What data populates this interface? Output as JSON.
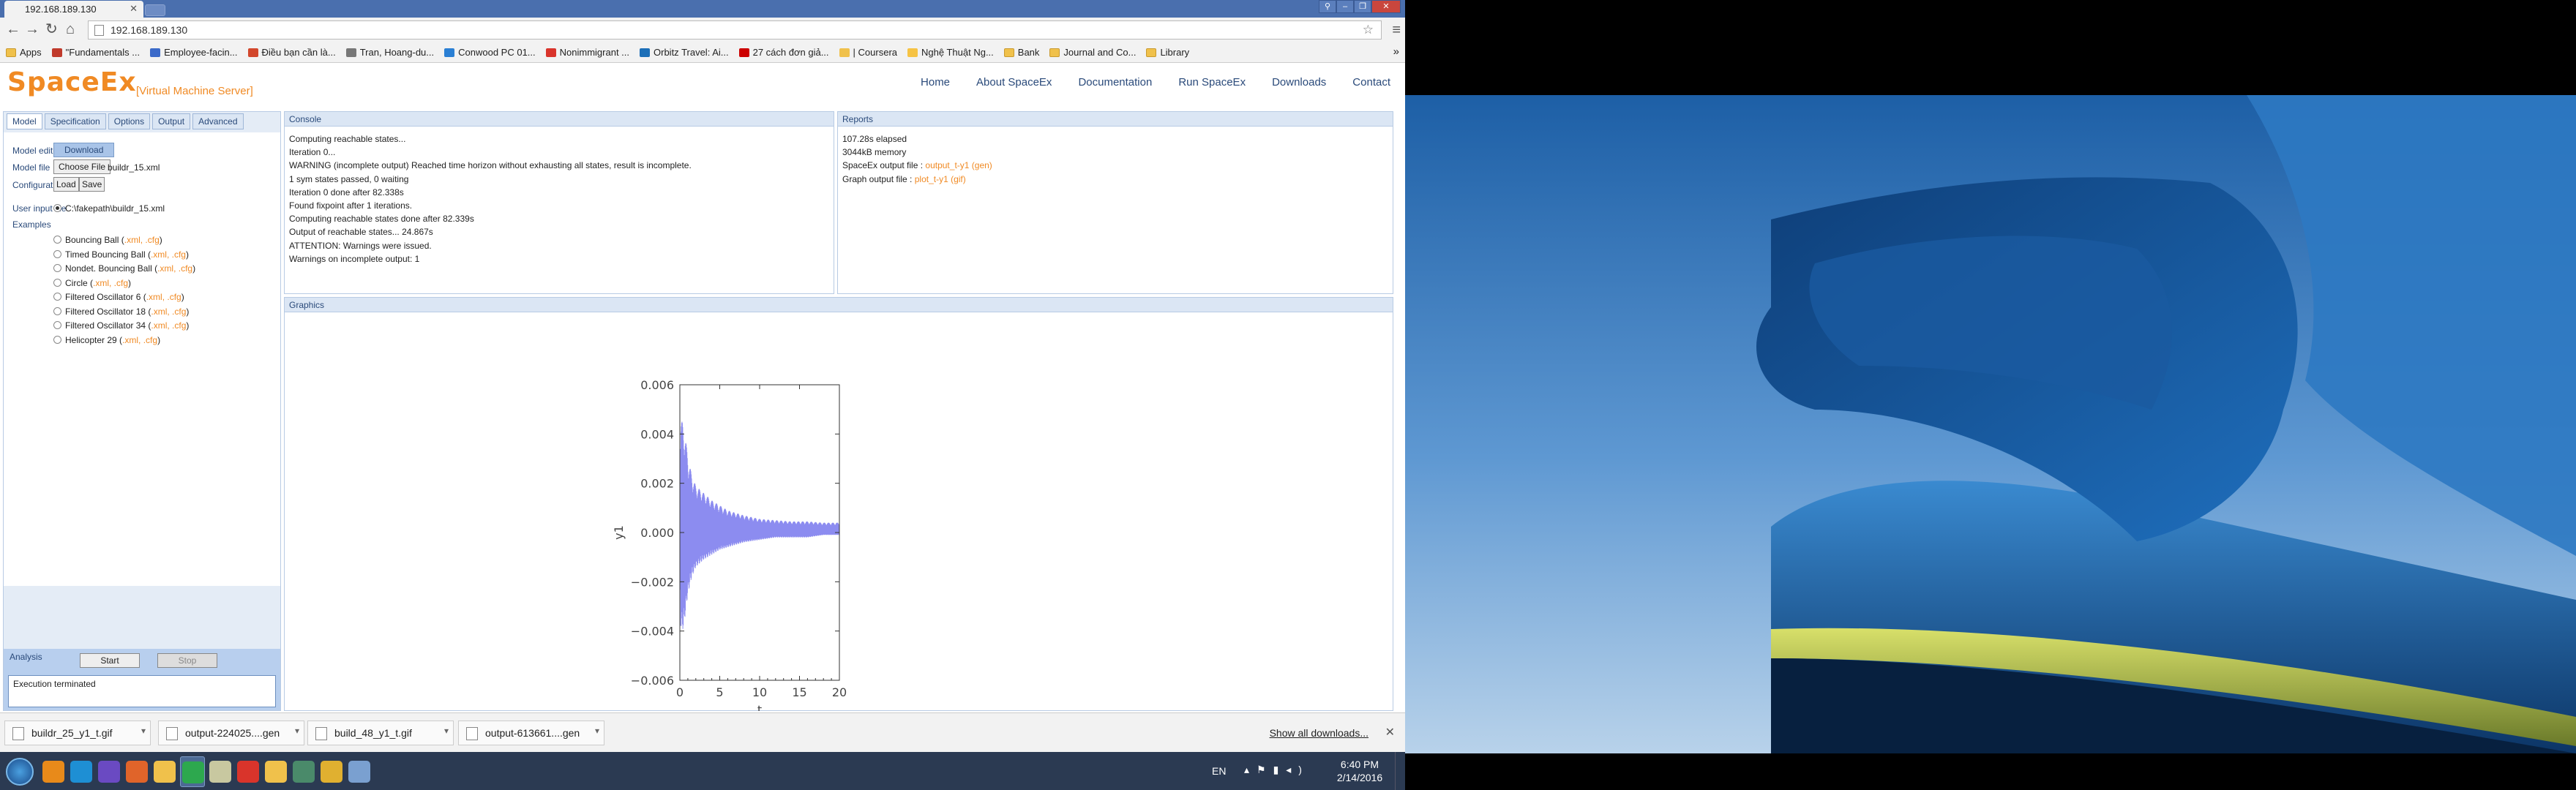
{
  "browser": {
    "tab_title": "192.168.189.130",
    "url": "192.168.189.130",
    "bookmarks": [
      "Apps",
      "\"Fundamentals ...",
      "Employee-facin...",
      "Điều bạn cần là...",
      "Tran, Hoang-du...",
      "Conwood PC 01...",
      "Nonimmigrant ...",
      "Orbitz Travel: Ai...",
      "27 cách đơn giả...",
      "| Coursera",
      "Nghệ Thuật Ng...",
      "Bank",
      "Journal and Co...",
      "Library"
    ],
    "bookmarks_more": "»"
  },
  "site": {
    "logo": "SpaceEx",
    "logo_sub": "[Virtual Machine Server]",
    "nav": [
      "Home",
      "About SpaceEx",
      "Documentation",
      "Run SpaceEx",
      "Downloads",
      "Contact"
    ]
  },
  "side": {
    "tabs": [
      "Model",
      "Specification",
      "Options",
      "Output",
      "Advanced"
    ],
    "model_editor_label": "Model editor",
    "download_btn": "Download",
    "model_file_label": "Model file",
    "choose_file_btn": "Choose File",
    "model_file_name": "buildr_15.xml",
    "config_file_label": "Configuration file",
    "load_btn": "Load",
    "save_btn": "Save",
    "user_input_label": "User input file",
    "user_input_value": "C:\\fakepath\\buildr_15.xml",
    "examples_label": "Examples",
    "examples": [
      {
        "name": "Bouncing Ball",
        "links": ".xml, .cfg"
      },
      {
        "name": "Timed Bouncing Ball",
        "links": ".xml, .cfg"
      },
      {
        "name": "Nondet. Bouncing Ball",
        "links": ".xml, .cfg"
      },
      {
        "name": "Circle",
        "links": ".xml, .cfg"
      },
      {
        "name": "Filtered Oscillator 6",
        "links": ".xml, .cfg"
      },
      {
        "name": "Filtered Oscillator 18",
        "links": ".xml, .cfg"
      },
      {
        "name": "Filtered Oscillator 34",
        "links": ".xml, .cfg"
      },
      {
        "name": "Helicopter 29",
        "links": ".xml, .cfg"
      }
    ],
    "analysis_label": "Analysis",
    "start_btn": "Start",
    "stop_btn": "Stop",
    "status_text": "Execution terminated"
  },
  "console": {
    "title": "Console",
    "lines": [
      "Computing reachable states...",
      "Iteration 0...",
      "WARNING (incomplete output) Reached time horizon without exhausting all states, result is incomplete.",
      "1 sym states passed, 0 waiting",
      "Iteration 0 done after 82.338s",
      "Found fixpoint after 1 iterations.",
      "Computing reachable states done after 82.339s",
      "Output of reachable states... 24.867s",
      "ATTENTION: Warnings were issued.",
      "Warnings on incomplete output: 1"
    ]
  },
  "reports": {
    "title": "Reports",
    "elapsed": "107.28s elapsed",
    "memory": "3044kB memory",
    "spaceex_output_label": "SpaceEx output file : ",
    "spaceex_output_link": "output_t-y1 (gen)",
    "graph_output_label": "Graph output file : ",
    "graph_output_link": "plot_t-y1 (gif)"
  },
  "graphics": {
    "title": "Graphics"
  },
  "chart_data": {
    "type": "line",
    "xlabel": "t",
    "ylabel": "y1",
    "xlim": [
      0,
      20
    ],
    "ylim": [
      -0.006,
      0.006
    ],
    "xticks": [
      "0",
      "5",
      "10",
      "15",
      "20"
    ],
    "yticks": [
      "0.006",
      "0.004",
      "0.002",
      "0.000",
      "−0.002",
      "−0.004",
      "−0.006"
    ],
    "series": [
      {
        "color": "#8c8cf0",
        "envelope": {
          "t": [
            0,
            0.1,
            0.3,
            0.5,
            1,
            1.5,
            2,
            3,
            4,
            5,
            6,
            7,
            8,
            10,
            12,
            14,
            16,
            18,
            20
          ],
          "upper": [
            0,
            0.0045,
            0.0045,
            0.0043,
            0.0031,
            0.0023,
            0.0019,
            0.0016,
            0.0013,
            0.0011,
            0.0009,
            0.0008,
            0.0007,
            0.00055,
            0.0005,
            0.00045,
            0.00045,
            0.0004,
            0.0004
          ],
          "lower": [
            0,
            -0.0038,
            -0.004,
            -0.0038,
            -0.0025,
            -0.0018,
            -0.0014,
            -0.0011,
            -0.0009,
            -0.0007,
            -0.0006,
            -0.0005,
            -0.0004,
            -0.0003,
            -0.0002,
            -0.0002,
            -0.0002,
            -0.0001,
            -0.0001
          ]
        }
      }
    ]
  },
  "downloads": [
    {
      "name": "buildr_25_y1_t.gif"
    },
    {
      "name": "output-224025....gen"
    },
    {
      "name": "build_48_y1_t.gif"
    },
    {
      "name": "output-613661....gen"
    }
  ],
  "downloads_show_all": "Show all downloads...",
  "taskbar": {
    "lang": "EN",
    "time": "6:40 PM",
    "date": "2/14/2016",
    "apps": [
      "media-player",
      "internet-explorer",
      "visual-studio",
      "firefox",
      "file-explorer",
      "chrome",
      "dx",
      "pdf",
      "folder",
      "app-8",
      "app-9",
      "app-10"
    ]
  }
}
